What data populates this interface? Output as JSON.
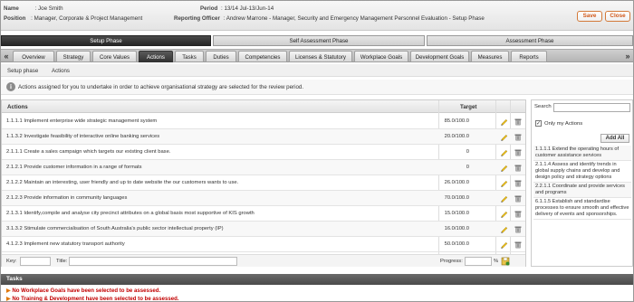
{
  "header": {
    "name_label": "Name",
    "name_value": ": Joe Smith",
    "position_label": "Position",
    "position_value": ": Manager, Corporate & Project Management",
    "period_label": "Period",
    "period_value": ": 13/14 Jul-13/Jun-14",
    "officer_label": "Reporting Officer",
    "officer_value": ": Andrew Marrone - Manager, Security and Emergency Management Personnel Evaluation - Setup Phase",
    "save_label": "Save",
    "close_label": "Close"
  },
  "phases": [
    {
      "label": "Setup Phase",
      "active": true
    },
    {
      "label": "Self Assessment Phase",
      "active": false
    },
    {
      "label": "Assessment Phase",
      "active": false
    }
  ],
  "tabs": [
    {
      "label": "Overview"
    },
    {
      "label": "Strategy"
    },
    {
      "label": "Core Values"
    },
    {
      "label": "Actions"
    },
    {
      "label": "Tasks"
    },
    {
      "label": "Duties"
    },
    {
      "label": "Competencies"
    },
    {
      "label": "Licenses & Statutory"
    },
    {
      "label": "Workplace Goals"
    },
    {
      "label": "Development Goals"
    },
    {
      "label": "Measures"
    },
    {
      "label": "Reports"
    }
  ],
  "active_tab": "Actions",
  "breadcrumb": [
    "Setup phase",
    "Actions"
  ],
  "info_text": "Actions assigned for you to undertake in order to achieve organisational strategy are selected for the review period.",
  "table": {
    "col_actions": "Actions",
    "col_target": "Target",
    "rows": [
      {
        "action": "1.1.1.1 Implement enterprise wide strategic management system",
        "target": "85.0/100.0"
      },
      {
        "action": "1.1.3.2 Investigate feasibility of interactive online banking services",
        "target": "20.0/100.0"
      },
      {
        "action": "2.1.1.1 Create a sales campaign which targets our existing client base.",
        "target": "0"
      },
      {
        "action": "2.1.2.1 Provide customer information in a range of formats",
        "target": "0"
      },
      {
        "action": "2.1.2.2 Maintain an interesting, user friendly and up to date website the our customers wants to use.",
        "target": "26.0/100.0"
      },
      {
        "action": "2.1.2.3 Provide information in community languages",
        "target": "70.0/100.0"
      },
      {
        "action": "2.1.3.1 Identify,compile and analyse city precinct attributes on a global basis most supportive of KIS growth",
        "target": "15.0/100.0"
      },
      {
        "action": "3.1.3.2 Stimulate commercialisation of South Australia's public sector intellectual property (IP)",
        "target": "16.0/100.0"
      },
      {
        "action": "4.1.2.3 Implement new statutory transport authority",
        "target": "50.0/100.0"
      }
    ],
    "footer": {
      "key_label": "Key:",
      "title_label": "Title:",
      "progress_label": "Progress:",
      "percent": "%"
    }
  },
  "right_panel": {
    "search_label": "Search",
    "only_my_label": "Only my Actions",
    "only_my_checked": true,
    "add_all_label": "Add All",
    "items": [
      "1.1.1.1 Extend the operating hours of customer assistance services",
      "2.1.1.4 Assess and identify trends in global supply chains and develop and design policy and strategy options",
      "2.2.1.1 Coordinate and provide services and programs",
      "6.1.1.5 Establish and standardise processes to ensure smooth and effective delivery of events and sponsorships."
    ]
  },
  "tasks": {
    "title": "Tasks",
    "messages": [
      "No Workplace Goals have been selected to be assessed.",
      "No Training & Development have been selected to be assessed."
    ]
  },
  "colors": {
    "accent_orange": "#d0581a",
    "active_dark": "#333333",
    "error_red": "#c20000"
  }
}
